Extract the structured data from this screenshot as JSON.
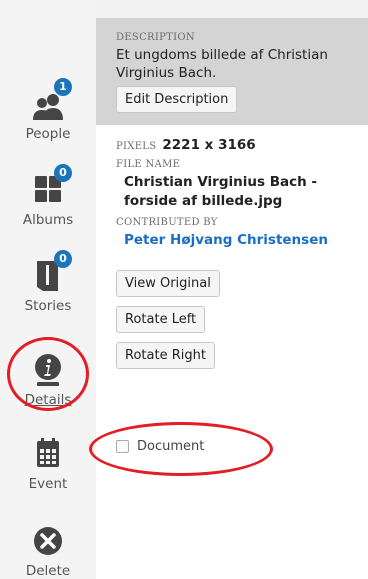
{
  "sidebar": {
    "items": [
      {
        "label": "People",
        "badge": "1",
        "icon": "people-icon"
      },
      {
        "label": "Albums",
        "badge": "0",
        "icon": "albums-icon"
      },
      {
        "label": "Stories",
        "badge": "0",
        "icon": "stories-icon"
      },
      {
        "label": "Details",
        "icon": "info-icon"
      },
      {
        "label": "Event",
        "icon": "calendar-icon"
      },
      {
        "label": "Delete",
        "icon": "close-icon"
      }
    ]
  },
  "description": {
    "heading": "DESCRIPTION",
    "text": "Et ungdoms billede af Christian Virginius Bach.",
    "edit_label": "Edit Description"
  },
  "info": {
    "pixels_label": "PIXELS",
    "pixels_value": "2221 x 3166",
    "filename_label": "FILE NAME",
    "filename_value": "Christian Virginius Bach - forside af billede.jpg",
    "contributed_label": "CONTRIBUTED BY",
    "contributed_value": "Peter Højvang Christensen"
  },
  "actions": {
    "view_original": "View Original",
    "rotate_left": "Rotate Left",
    "rotate_right": "Rotate Right"
  },
  "document": {
    "label": "Document"
  },
  "colors": {
    "accent": "#1a75bb",
    "link": "#1a6fc4",
    "highlight": "#e31e24"
  }
}
